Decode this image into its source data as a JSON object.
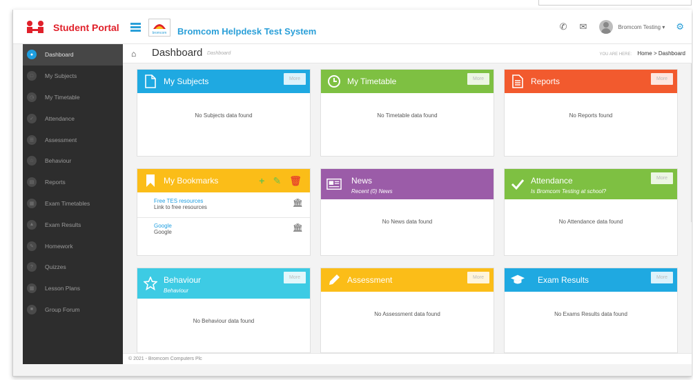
{
  "header": {
    "portal_title": "Student Portal",
    "system_title": "Bromcom Helpdesk Test System",
    "helpdesk_logo_text": "bromcom",
    "user_name": "Bromcom Testing ▾",
    "icons": [
      "phone-icon",
      "envelope-icon",
      "gear-icon"
    ]
  },
  "sidebar": {
    "items": [
      {
        "label": "Dashboard",
        "active": true
      },
      {
        "label": "My Subjects"
      },
      {
        "label": "My Timetable"
      },
      {
        "label": "Attendance"
      },
      {
        "label": "Assessment"
      },
      {
        "label": "Behaviour"
      },
      {
        "label": "Reports"
      },
      {
        "label": "Exam Timetables"
      },
      {
        "label": "Exam Results"
      },
      {
        "label": "Homework"
      },
      {
        "label": "Quizzes"
      },
      {
        "label": "Lesson Plans"
      },
      {
        "label": "Group Forum"
      }
    ]
  },
  "page": {
    "title": "Dashboard",
    "subtitle": "Dashboard",
    "crumb_label": "YOU ARE HERE:",
    "crumb_path": "Home > Dashboard"
  },
  "cards": {
    "subjects": {
      "title": "My Subjects",
      "more": "More",
      "empty": "No Subjects data found",
      "color": "#1fa9e1"
    },
    "timetable": {
      "title": "My Timetable",
      "more": "More",
      "empty": "No Timetable data found",
      "color": "#7ec042"
    },
    "reports": {
      "title": "Reports",
      "more": "More",
      "empty": "No Reports found",
      "color": "#f25a2e"
    },
    "bookmarks": {
      "title": "My Bookmarks",
      "color": "#fbbd18",
      "items": [
        {
          "link": "Free TES resources",
          "desc": "Link to free resources"
        },
        {
          "link": "Google",
          "desc": "Google"
        }
      ]
    },
    "news": {
      "title": "News",
      "subtitle": "Recent (0) News",
      "empty": "No News data found",
      "color": "#9b5ca8"
    },
    "attendance": {
      "title": "Attendance",
      "subtitle": "Is Bromcom Testing at school?",
      "more": "More",
      "empty": "No Attendance data found",
      "color": "#7ec042"
    },
    "behaviour": {
      "title": "Behaviour",
      "subtitle": "Behaviour",
      "more": "More",
      "empty": "No Behaviour data found",
      "color": "#3dcbe4"
    },
    "assessment": {
      "title": "Assessment",
      "more": "More",
      "empty": "No Assessment data found",
      "color": "#fbbd18"
    },
    "exam_results": {
      "title": "Exam Results",
      "more": "More",
      "empty": "No Exams Results data found",
      "color": "#1fa9e1"
    }
  },
  "footer": {
    "text": "© 2021 - Bromcom Computers Plc"
  }
}
